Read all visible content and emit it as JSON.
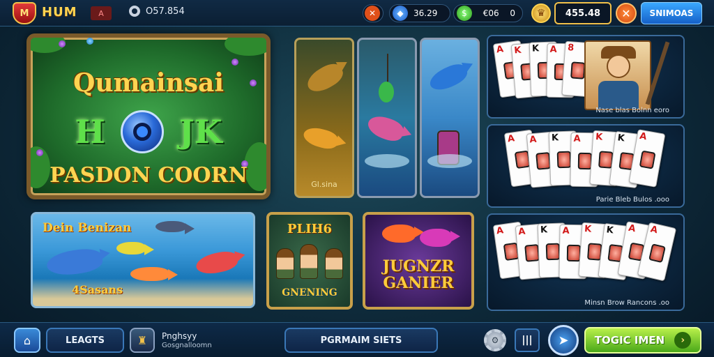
{
  "topbar": {
    "logo_badge": "M",
    "logo_text": "HUM",
    "logo_tag": "A",
    "user_id": "O57.854",
    "stat1_icon": "✕",
    "stat2_value": "36.29",
    "stat3_value": "€06",
    "stat3_extra": "0",
    "crown_icon": "♛",
    "gold_value": "455.48",
    "close_label": "✕",
    "action_button": "SNIMOAS"
  },
  "tiles": {
    "feature_title": "Qumainsai",
    "feature_left": "H",
    "feature_right": "JK",
    "feature_sub": "PASDON COORN",
    "fish_col1_label": "Gl.sina",
    "cards_label_1": "Nase blas Bolnn eoro",
    "cards_label_2": "Parie Bleb Bulos .ooo",
    "cards_label_3": "Minsn Brow Rancons .oo",
    "ocean_title": "Dein Benizan",
    "ocean_bottom": "4Sasans",
    "explorers_title": "PLIH6",
    "explorers_sub": "GNENING",
    "jungle_title_1": "JUGNZR",
    "jungle_title_2": "GANIER"
  },
  "cards": {
    "r1": [
      "A",
      "K",
      "K",
      "A",
      "8"
    ],
    "r2": [
      "A",
      "A",
      "K",
      "A",
      "K",
      "K",
      "A"
    ],
    "r3": [
      "A",
      "A",
      "K",
      "A",
      "K",
      "K",
      "A",
      "A"
    ]
  },
  "bottombar": {
    "home_icon": "⌂",
    "leagues_label": "LEAGTS",
    "avatar_icon": "♜",
    "profile_name": "Pnghsyy",
    "profile_sub": "Gosgnalloomn",
    "center_button": "PGRMAIM SIETS",
    "gear_icon": "⚙",
    "pause_icon": "|||",
    "compass_icon": "➤",
    "play_button": "TOGIC IMEN",
    "play_arrow": "›"
  },
  "colors": {
    "accent_gold": "#ffd451",
    "play_green": "#4aa81a",
    "panel_blue": "#1560c8"
  }
}
